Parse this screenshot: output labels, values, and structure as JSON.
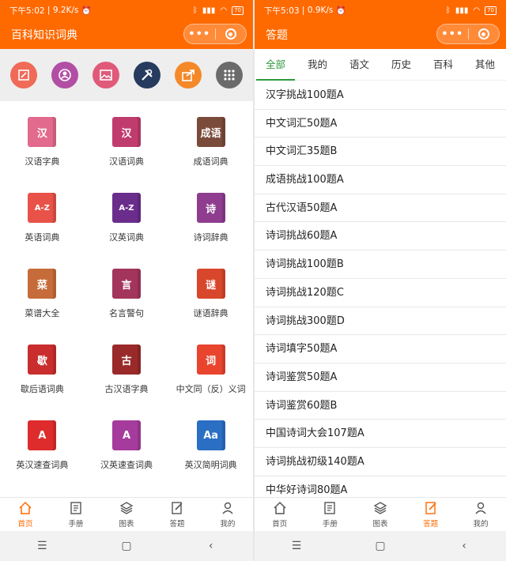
{
  "left": {
    "status": {
      "time": "下午5:02",
      "speed": "9.2K/s",
      "battery": "70"
    },
    "title": "百科知识词典",
    "shortcuts": [
      {
        "name": "edit-icon",
        "color": "#f06a58"
      },
      {
        "name": "user-circle-icon",
        "color": "#b24fa4"
      },
      {
        "name": "picture-icon",
        "color": "#e05a7a"
      },
      {
        "name": "tools-icon",
        "color": "#263b5e"
      },
      {
        "name": "share-icon",
        "color": "#f4892a"
      },
      {
        "name": "grid-icon",
        "color": "#6b6b6b"
      }
    ],
    "dictionaries": [
      {
        "label": "汉语字典",
        "glyph": "汉",
        "color": "#e26a8c"
      },
      {
        "label": "汉语词典",
        "glyph": "汉",
        "color": "#c13c6e"
      },
      {
        "label": "成语词典",
        "glyph": "成语",
        "color": "#7a4a3a"
      },
      {
        "label": "英语词典",
        "glyph": "A-Z",
        "color": "#e85248"
      },
      {
        "label": "汉英词典",
        "glyph": "A-Z",
        "color": "#6a2d8c"
      },
      {
        "label": "诗词辞典",
        "glyph": "诗",
        "color": "#8e3d8f"
      },
      {
        "label": "菜谱大全",
        "glyph": "菜",
        "color": "#c66c3a"
      },
      {
        "label": "名言警句",
        "glyph": "言",
        "color": "#a3345b"
      },
      {
        "label": "谜语辞典",
        "glyph": "谜",
        "color": "#d8472b"
      },
      {
        "label": "歇后语词典",
        "glyph": "歇",
        "color": "#c92d2d"
      },
      {
        "label": "古汉语字典",
        "glyph": "古",
        "color": "#9a2a2a"
      },
      {
        "label": "中文同（反）义词",
        "glyph": "词",
        "color": "#e8442e"
      },
      {
        "label": "英汉速查词典",
        "glyph": "A",
        "color": "#de2c2c"
      },
      {
        "label": "汉英速查词典",
        "glyph": "A",
        "color": "#a53b9c"
      },
      {
        "label": "英汉简明词典",
        "glyph": "Aa",
        "color": "#2a6fc4"
      }
    ]
  },
  "right": {
    "status": {
      "time": "下午5:03",
      "speed": "0.9K/s",
      "battery": "70"
    },
    "title": "答题",
    "tabs": [
      "全部",
      "我的",
      "语文",
      "历史",
      "百科",
      "其他"
    ],
    "active_tab": 0,
    "quizzes": [
      "汉字挑战100题A",
      "中文词汇50题A",
      "中文词汇35题B",
      "成语挑战100题A",
      "古代汉语50题A",
      "诗词挑战60题A",
      "诗词挑战100题B",
      "诗词挑战120题C",
      "诗词挑战300题D",
      "诗词填字50题A",
      "诗词鉴赏50题A",
      "诗词鉴赏60题B",
      "中国诗词大会107题A",
      "诗词挑战初级140题A",
      "中华好诗词80题A"
    ]
  },
  "tabbar": [
    {
      "label": "首页",
      "icon": "home-icon"
    },
    {
      "label": "手册",
      "icon": "manual-icon"
    },
    {
      "label": "图表",
      "icon": "layers-icon"
    },
    {
      "label": "答题",
      "icon": "answer-icon"
    },
    {
      "label": "我的",
      "icon": "person-icon"
    }
  ],
  "colors": {
    "accent": "#ff6a00",
    "tab_active": "#2e9a3e"
  }
}
